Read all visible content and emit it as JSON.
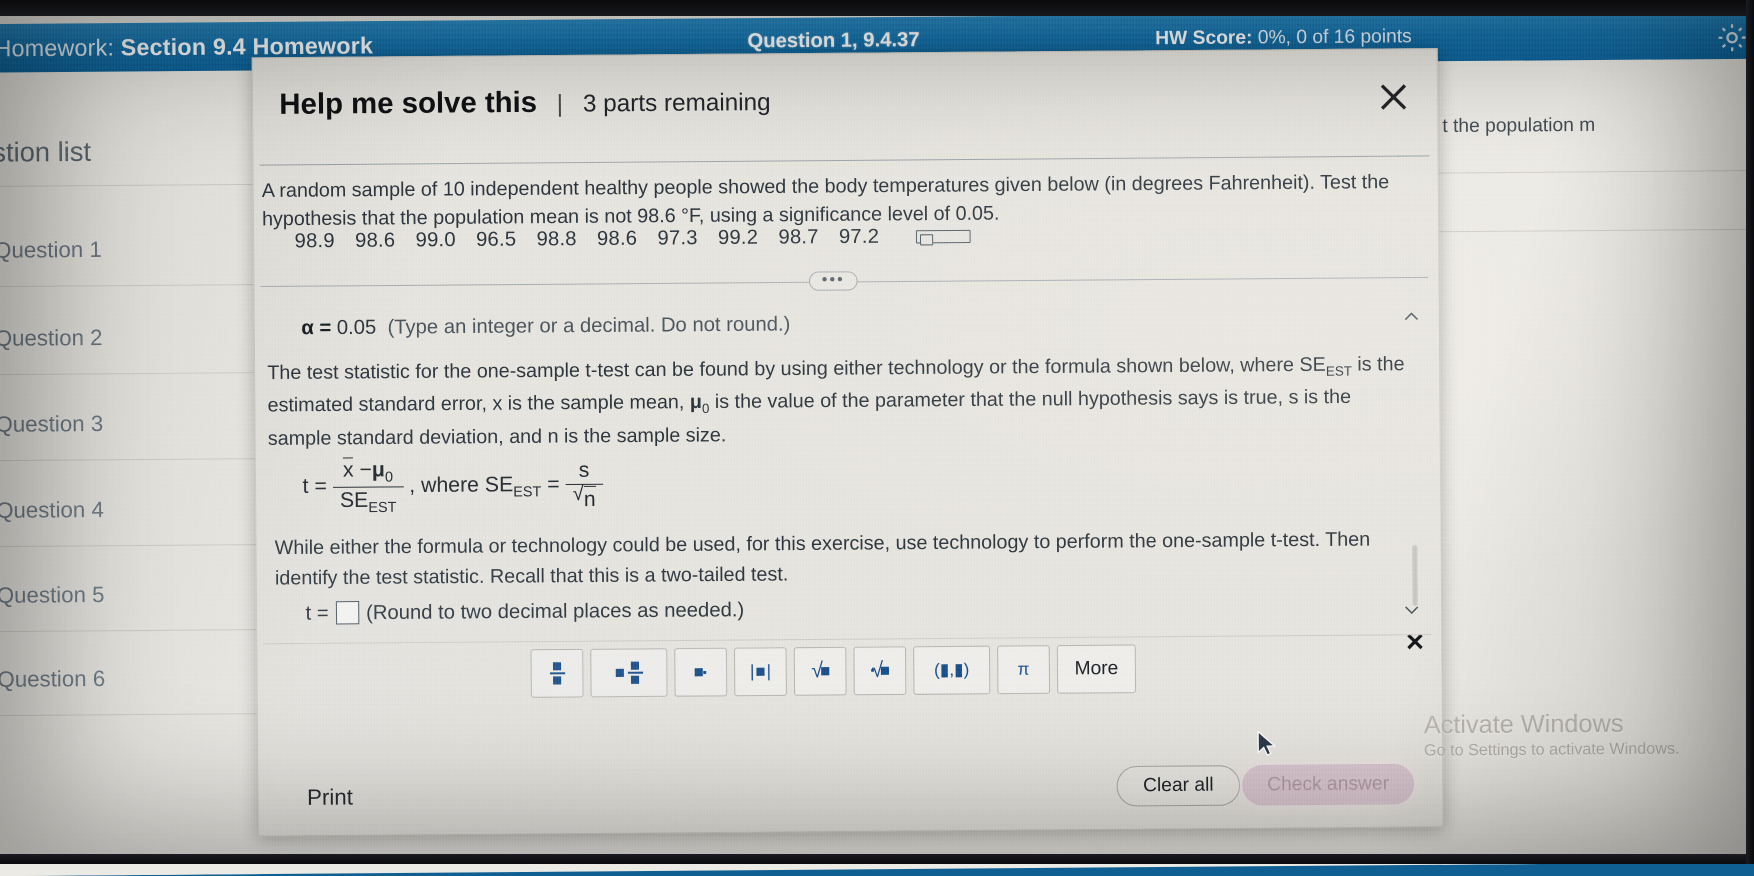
{
  "topbar": {
    "homework_prefix": "Homework:",
    "homework_name": "Section 9.4 Homework",
    "question_id": "Question 1, 9.4.37",
    "score_label": "HW Score:",
    "score_value": "0%, 0 of 16 points",
    "gear_icon": "gear-icon",
    "accent_color": "#1772ab"
  },
  "sidebar": {
    "title": "estion list",
    "items": [
      {
        "label": "Question 1"
      },
      {
        "label": "Question 2"
      },
      {
        "label": "Question 3"
      },
      {
        "label": "Question 4"
      },
      {
        "label": "Question 5"
      },
      {
        "label": "Question 6"
      }
    ]
  },
  "right_strip": {
    "cut_text": "t the population m"
  },
  "modal": {
    "title": "Help me solve this",
    "separator": "|",
    "parts_remaining": "3 parts remaining",
    "close_icon": "close-icon",
    "statement": "A random sample of 10 independent healthy people showed the body temperatures given below (in degrees Fahrenheit). Test the hypothesis that the population mean is not 98.6 °F, using a significance level of 0.05.",
    "data_values": [
      "98.9",
      "98.6",
      "99.0",
      "96.5",
      "98.8",
      "98.6",
      "97.3",
      "99.2",
      "98.7",
      "97.2"
    ],
    "copy_icon": "copy-icon",
    "overflow_dots": "•••",
    "alpha_symbol": "α =",
    "alpha_value": "0.05",
    "alpha_hint": "(Type an integer or a decimal. Do not round.)",
    "paragraph_part1": "The test statistic for the one-sample t-test can be found by using either technology or the formula shown below, where SE",
    "paragraph_sub1": "EST",
    "paragraph_part2": " is the estimated standard error, x is the sample mean, ",
    "paragraph_mu": "μ",
    "paragraph_sub2": "0",
    "paragraph_part3": " is the value of the parameter that the null hypothesis says is true, s is the sample standard deviation, and n is the sample size.",
    "formula": {
      "t_label": "t =",
      "numerator_x": "x",
      "numerator_minus": "−",
      "numerator_mu": "μ",
      "numerator_mu_sub": "0",
      "denominator": "SE",
      "denominator_sub": "EST",
      "where_label": ", where SE",
      "where_sub": "EST",
      "equals": "=",
      "se_numerator": "s",
      "se_denominator": "n"
    },
    "paragraph2": "While either the formula or technology could be used, for this exercise, use technology to perform the one-sample t-test. Then identify the test statistic. Recall that this is a two-tailed test.",
    "answer_label": "t =",
    "answer_value": "",
    "answer_hint": "(Round to two decimal places as needed.)",
    "chevron_up_icon": "chevron-up-icon",
    "chevron_down_icon": "chevron-down-icon",
    "close_small_icon": "close-small-icon",
    "math_keys": [
      {
        "name": "fraction",
        "label": "fraction-key"
      },
      {
        "name": "mixed-number",
        "label": "mixed-number-key"
      },
      {
        "name": "exponent",
        "label": "exponent-key"
      },
      {
        "name": "absolute-value",
        "label": "absolute-value-key"
      },
      {
        "name": "square-root",
        "label": "square-root-key"
      },
      {
        "name": "nth-root",
        "label": "nth-root-key"
      },
      {
        "name": "interval",
        "label": "(▮,▮)"
      },
      {
        "name": "pi",
        "label": "π"
      },
      {
        "name": "more",
        "label": "More"
      }
    ],
    "print_label": "Print",
    "clear_all_label": "Clear all",
    "check_answer_label": "Check answer"
  },
  "watermark": {
    "line1": "Activate Windows",
    "line2": "Go to Settings to activate Windows."
  },
  "cursor": {
    "name": "mouse-pointer"
  }
}
